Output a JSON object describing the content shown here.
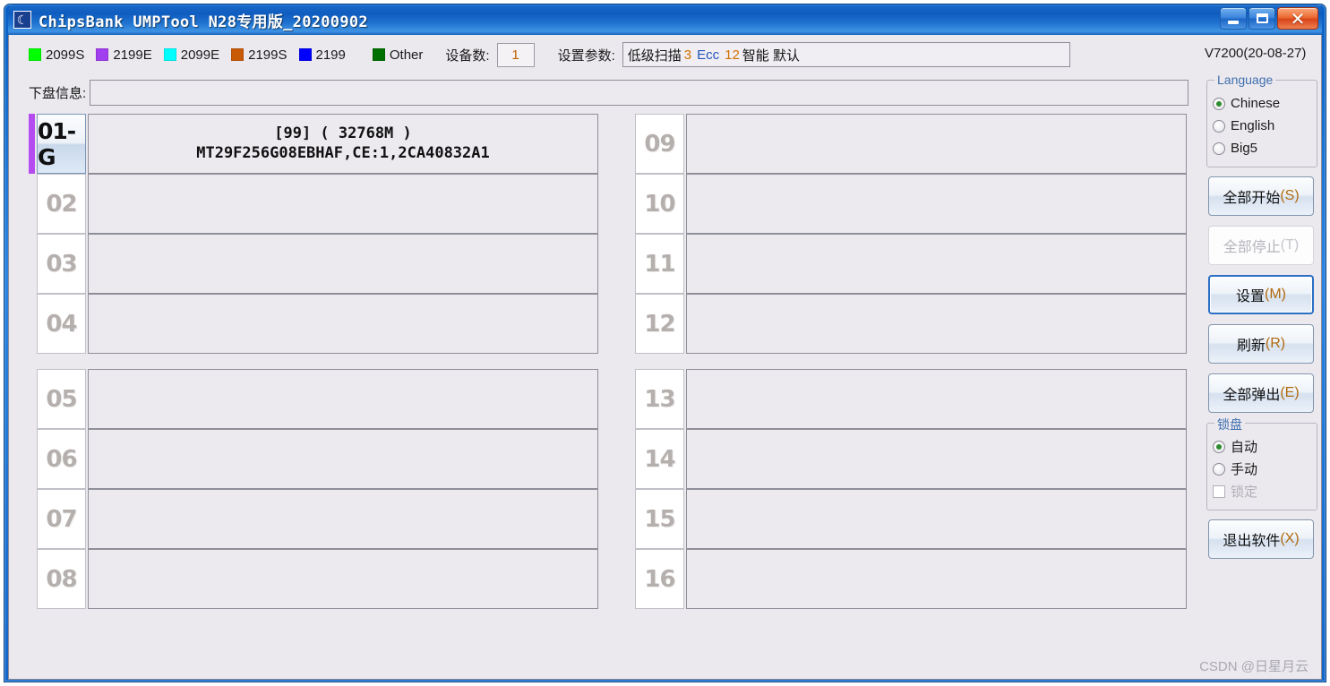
{
  "window": {
    "title": "ChipsBank UMPTool N28专用版_20200902",
    "icon": "app-logo-icon",
    "minimize_label": "minimize-icon",
    "maximize_label": "maximize-icon",
    "close_label": "✕"
  },
  "legend": [
    {
      "label": "2099S",
      "color": "#00ff00"
    },
    {
      "label": "2199E",
      "color": "#a13ef0"
    },
    {
      "label": "2099E",
      "color": "#00ffff"
    },
    {
      "label": "2199S",
      "color": "#c85a06"
    },
    {
      "label": "2199",
      "color": "#0000ff"
    },
    {
      "label": "Other",
      "color": "#007000"
    }
  ],
  "toolbar": {
    "device_count_label": "设备数:",
    "device_count_value": "1",
    "param_label": "设置参数:",
    "param_value_full": "低级扫描 3 Ecc 12 智能 默认",
    "param_parts": {
      "p1": "低级扫描",
      "p2": "3",
      "p3": "Ecc",
      "p4": "12",
      "p5": "智能 默认"
    },
    "version": "V7200(20-08-27)"
  },
  "info_row": {
    "label": "下盘信息:",
    "value": ""
  },
  "slots": [
    {
      "num": "01-G",
      "active": true,
      "flag_color": "#b44cf0",
      "line1": "[99] ( 32768M )",
      "line2": "MT29F256G08EBHAF,CE:1,2CA40832A1"
    },
    {
      "num": "09",
      "active": false,
      "flag_color": "",
      "line1": "",
      "line2": ""
    },
    {
      "num": "02",
      "active": false,
      "flag_color": "",
      "line1": "",
      "line2": ""
    },
    {
      "num": "10",
      "active": false,
      "flag_color": "",
      "line1": "",
      "line2": ""
    },
    {
      "num": "03",
      "active": false,
      "flag_color": "",
      "line1": "",
      "line2": ""
    },
    {
      "num": "11",
      "active": false,
      "flag_color": "",
      "line1": "",
      "line2": ""
    },
    {
      "num": "04",
      "active": false,
      "flag_color": "",
      "line1": "",
      "line2": ""
    },
    {
      "num": "12",
      "active": false,
      "flag_color": "",
      "line1": "",
      "line2": ""
    },
    {
      "num": "05",
      "active": false,
      "flag_color": "",
      "line1": "",
      "line2": ""
    },
    {
      "num": "13",
      "active": false,
      "flag_color": "",
      "line1": "",
      "line2": ""
    },
    {
      "num": "06",
      "active": false,
      "flag_color": "",
      "line1": "",
      "line2": ""
    },
    {
      "num": "14",
      "active": false,
      "flag_color": "",
      "line1": "",
      "line2": ""
    },
    {
      "num": "07",
      "active": false,
      "flag_color": "",
      "line1": "",
      "line2": ""
    },
    {
      "num": "15",
      "active": false,
      "flag_color": "",
      "line1": "",
      "line2": ""
    },
    {
      "num": "08",
      "active": false,
      "flag_color": "",
      "line1": "",
      "line2": ""
    },
    {
      "num": "16",
      "active": false,
      "flag_color": "",
      "line1": "",
      "line2": ""
    }
  ],
  "language_group": {
    "title": "Language",
    "options": [
      {
        "label": "Chinese",
        "selected": true
      },
      {
        "label": "English",
        "selected": false
      },
      {
        "label": "Big5",
        "selected": false
      }
    ]
  },
  "buttons": {
    "start_all": {
      "text": "全部开始",
      "mnemonic": "(S)",
      "disabled": false,
      "focused": false
    },
    "stop_all": {
      "text": "全部停止",
      "mnemonic": "(T)",
      "disabled": true,
      "focused": false
    },
    "settings": {
      "text": "设置",
      "mnemonic": "(M)",
      "disabled": false,
      "focused": true
    },
    "refresh": {
      "text": "刷新",
      "mnemonic": "(R)",
      "disabled": false,
      "focused": false
    },
    "eject_all": {
      "text": "全部弹出",
      "mnemonic": "(E)",
      "disabled": false,
      "focused": false
    },
    "exit": {
      "text": "退出软件",
      "mnemonic": "(X)",
      "disabled": false,
      "focused": false
    }
  },
  "lock_group": {
    "title": "锁盘",
    "options": [
      {
        "label": "自动",
        "selected": true
      },
      {
        "label": "手动",
        "selected": false
      }
    ],
    "checkbox": {
      "label": "锁定",
      "checked": false,
      "disabled": true
    }
  },
  "watermark": "CSDN @日星月云"
}
